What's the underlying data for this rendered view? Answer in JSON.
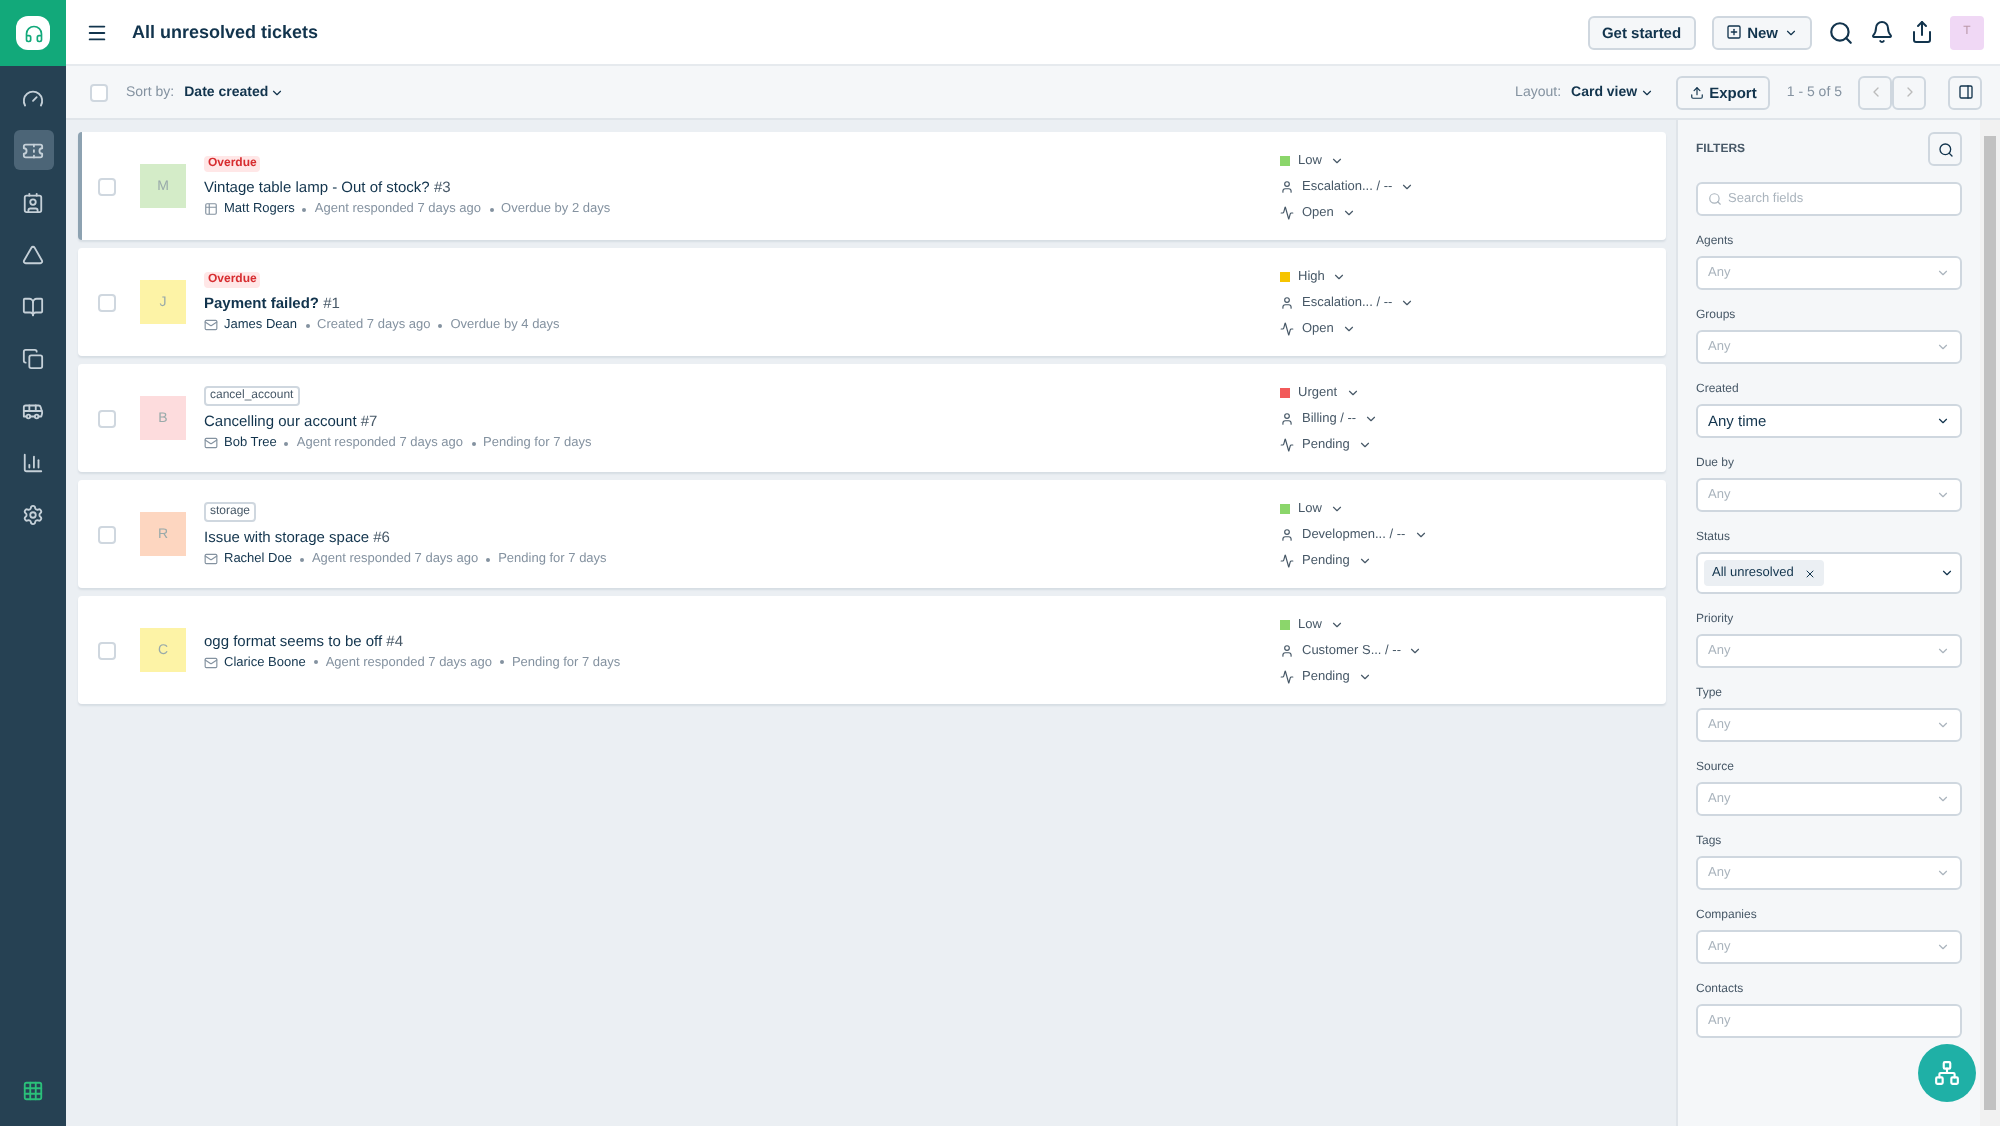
{
  "header": {
    "title": "All unresolved tickets",
    "buttons": [
      {
        "label": "Get started",
        "kind": "plain"
      },
      {
        "label": "New",
        "kind": "menu"
      }
    ],
    "avatar": "T"
  },
  "sidebar": {
    "items": [
      {
        "selected": false
      },
      {
        "selected": true
      },
      {
        "selected": false
      },
      {
        "selected": false
      },
      {
        "selected": false
      },
      {
        "selected": false
      },
      {
        "selected": false
      },
      {
        "selected": false
      },
      {
        "selected": false
      }
    ]
  },
  "toolbar": {
    "select_all_checked": false,
    "sort_label": "Sort by:",
    "sort_value": "Date created",
    "layout_label": "Layout:",
    "layout_value": "Card view",
    "export": "Export",
    "pagination": "1 - 5 of 5"
  },
  "tickets": [
    {
      "kind": "portal",
      "checked": false,
      "selected": true,
      "unread": false,
      "tag": {
        "label": "Overdue",
        "kind": "alert"
      },
      "avatar": {
        "letter": "M",
        "color": "#d4ecc8"
      },
      "title": "Vintage table lamp - Out of stock?",
      "number": "#3",
      "contact": "Matt Rogers",
      "activity": "Agent responded 7 days ago",
      "due": "Overdue by 2 days",
      "priority": {
        "label": "Low",
        "color": "#8bd66b"
      },
      "group": "Escalation... / --",
      "status": "Open"
    },
    {
      "kind": "email",
      "checked": false,
      "selected": false,
      "unread": true,
      "tag": {
        "label": "Overdue",
        "kind": "alert"
      },
      "avatar": {
        "letter": "J",
        "color": "#fdf3a6"
      },
      "title": "Payment failed?",
      "number": "#1",
      "contact": "James Dean",
      "activity": "Created 7 days ago",
      "due": "Overdue by 4 days",
      "priority": {
        "label": "High",
        "color": "#f6c400"
      },
      "group": "Escalation... / --",
      "status": "Open"
    },
    {
      "kind": "email",
      "checked": false,
      "selected": false,
      "unread": false,
      "tag": {
        "label": "cancel_account",
        "kind": "plain"
      },
      "avatar": {
        "letter": "B",
        "color": "#fddcdd"
      },
      "title": "Cancelling our account",
      "number": "#7",
      "contact": "Bob Tree",
      "activity": "Agent responded 7 days ago",
      "due": "Pending for 7 days",
      "priority": {
        "label": "Urgent",
        "color": "#f25a5a"
      },
      "group": "Billing / --",
      "status": "Pending"
    },
    {
      "kind": "email",
      "checked": false,
      "selected": false,
      "unread": false,
      "tag": {
        "label": "storage",
        "kind": "plain"
      },
      "avatar": {
        "letter": "R",
        "color": "#fdd6c0"
      },
      "title": "Issue with storage space",
      "number": "#6",
      "contact": "Rachel Doe",
      "activity": "Agent responded 7 days ago",
      "due": "Pending for 7 days",
      "priority": {
        "label": "Low",
        "color": "#8bd66b"
      },
      "group": "Developmen... / --",
      "status": "Pending"
    },
    {
      "kind": "email",
      "checked": false,
      "selected": false,
      "unread": false,
      "avatar": {
        "letter": "C",
        "color": "#fdf3a6"
      },
      "title": "ogg format seems to be off",
      "number": "#4",
      "contact": "Clarice Boone",
      "activity": "Agent responded 7 days ago",
      "due": "Pending for 7 days",
      "priority": {
        "label": "Low",
        "color": "#8bd66b"
      },
      "group": "Customer S... / --",
      "status": "Pending"
    }
  ],
  "filters": {
    "title": "FILTERS",
    "search_placeholder": "Search fields",
    "fields": [
      {
        "label": "Agents",
        "kind": "select",
        "placeholder": "Any"
      },
      {
        "label": "Groups",
        "kind": "select",
        "placeholder": "Any"
      },
      {
        "label": "Created",
        "kind": "select",
        "value": "Any time"
      },
      {
        "label": "Due by",
        "kind": "select",
        "placeholder": "Any"
      },
      {
        "label": "Status",
        "kind": "chip",
        "value": "All unresolved"
      },
      {
        "label": "Priority",
        "kind": "select",
        "placeholder": "Any"
      },
      {
        "label": "Type",
        "kind": "select",
        "placeholder": "Any"
      },
      {
        "label": "Source",
        "kind": "select",
        "placeholder": "Any"
      },
      {
        "label": "Tags",
        "kind": "select",
        "placeholder": "Any"
      },
      {
        "label": "Companies",
        "kind": "select",
        "placeholder": "Any"
      },
      {
        "label": "Contacts",
        "kind": "text",
        "placeholder": "Any"
      }
    ]
  }
}
